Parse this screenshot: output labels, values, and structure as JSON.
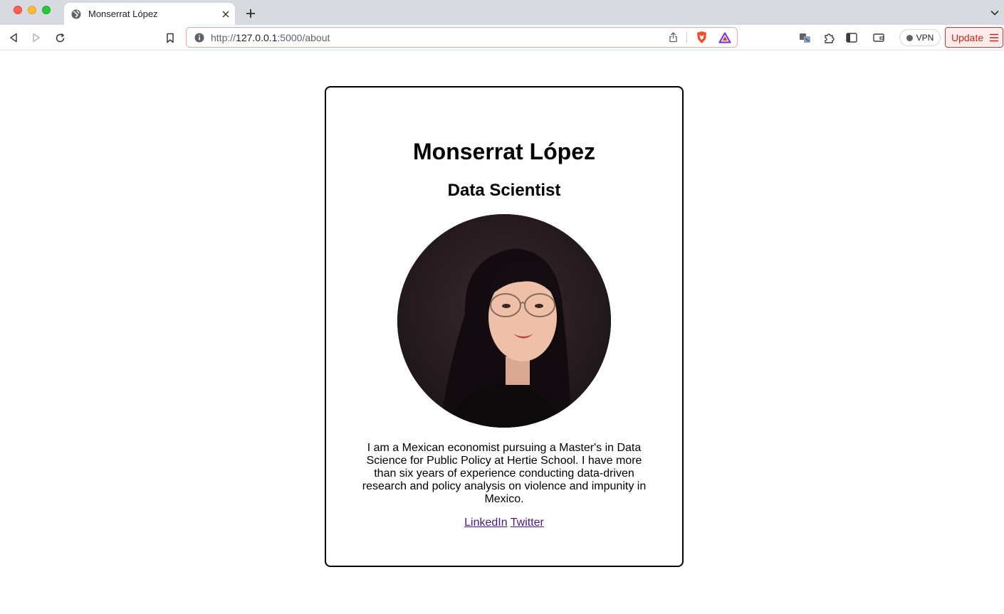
{
  "browser": {
    "tab": {
      "title": "Monserrat López"
    },
    "url": {
      "scheme": "http://",
      "host": "127.0.0.1",
      "rest": ":5000/about"
    },
    "vpn_label": "VPN",
    "update_label": "Update"
  },
  "profile": {
    "name": "Monserrat López",
    "role": "Data Scientist",
    "bio": "I am a Mexican economist pursuing a Master's in Data Science for Public Policy at Hertie School. I have more than six years of experience conducting data-driven research and policy analysis on violence and impunity in Mexico.",
    "links": [
      {
        "label": "LinkedIn"
      },
      {
        "label": "Twitter"
      }
    ]
  },
  "colors": {
    "link_visited": "#4b1a7f",
    "update_red": "#c1271e"
  }
}
